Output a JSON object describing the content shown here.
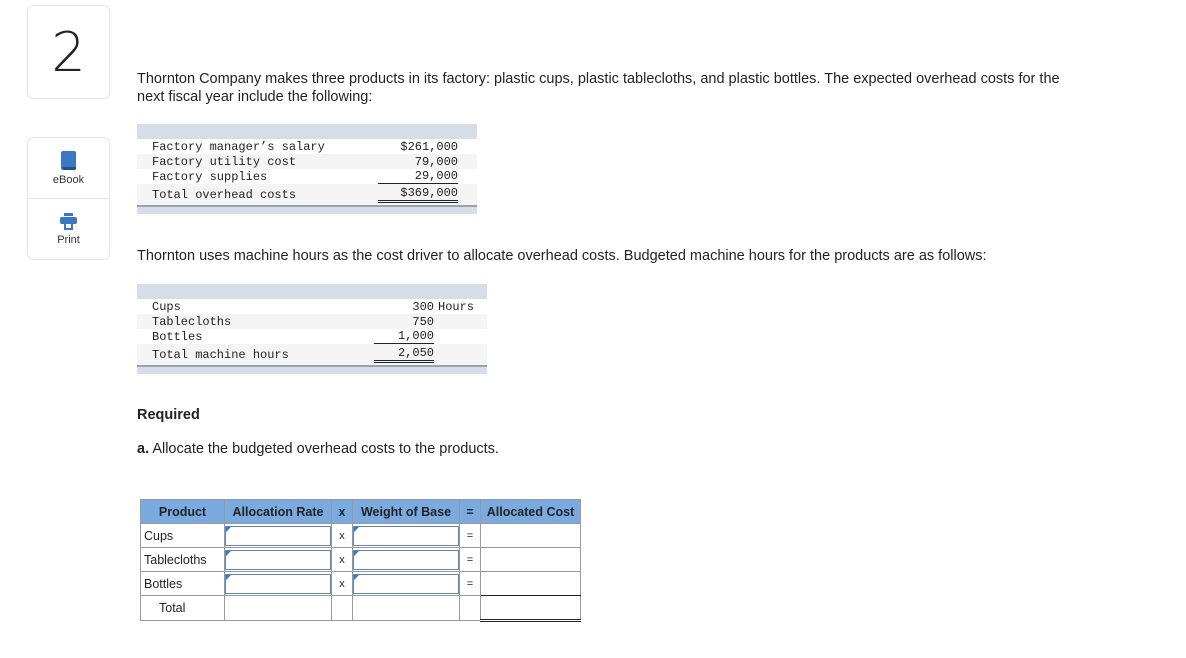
{
  "question": {
    "number": "2"
  },
  "tools": [
    {
      "label": "eBook",
      "icon": "book-icon"
    },
    {
      "label": "Print",
      "icon": "printer-icon"
    }
  ],
  "intro": "Thornton Company makes three products in its factory: plastic cups, plastic tablecloths, and plastic bottles. The expected overhead costs for the next fiscal year include the following:",
  "overhead_table": {
    "rows": [
      {
        "label": "Factory manager’s salary",
        "value": "$261,000"
      },
      {
        "label": "Factory utility cost",
        "value": "79,000"
      },
      {
        "label": "Factory supplies",
        "value": "29,000"
      }
    ],
    "total": {
      "label": "Total overhead costs",
      "value": "$369,000"
    }
  },
  "driver_text": "Thornton uses machine hours as the cost driver to allocate overhead costs. Budgeted machine hours for the products are as follows:",
  "hours_table": {
    "unit": "Hours",
    "rows": [
      {
        "label": "Cups",
        "value": "300"
      },
      {
        "label": "Tablecloths",
        "value": "750"
      },
      {
        "label": "Bottles",
        "value": "1,000"
      }
    ],
    "total": {
      "label": "Total machine hours",
      "value": "2,050"
    }
  },
  "required": {
    "heading": "Required",
    "part_label": "a.",
    "part_text": " Allocate the budgeted overhead costs to the products."
  },
  "answer_table": {
    "headers": [
      "Product",
      "Allocation Rate",
      "x",
      "Weight of Base",
      "=",
      "Allocated Cost"
    ],
    "rows": [
      {
        "product": "Cups",
        "op1": "x",
        "op2": "=",
        "rate": "",
        "weight": "",
        "cost": ""
      },
      {
        "product": "Tablecloths",
        "op1": "x",
        "op2": "=",
        "rate": "",
        "weight": "",
        "cost": ""
      },
      {
        "product": "Bottles",
        "op1": "x",
        "op2": "=",
        "rate": "",
        "weight": "",
        "cost": ""
      }
    ],
    "total_label": "Total"
  }
}
